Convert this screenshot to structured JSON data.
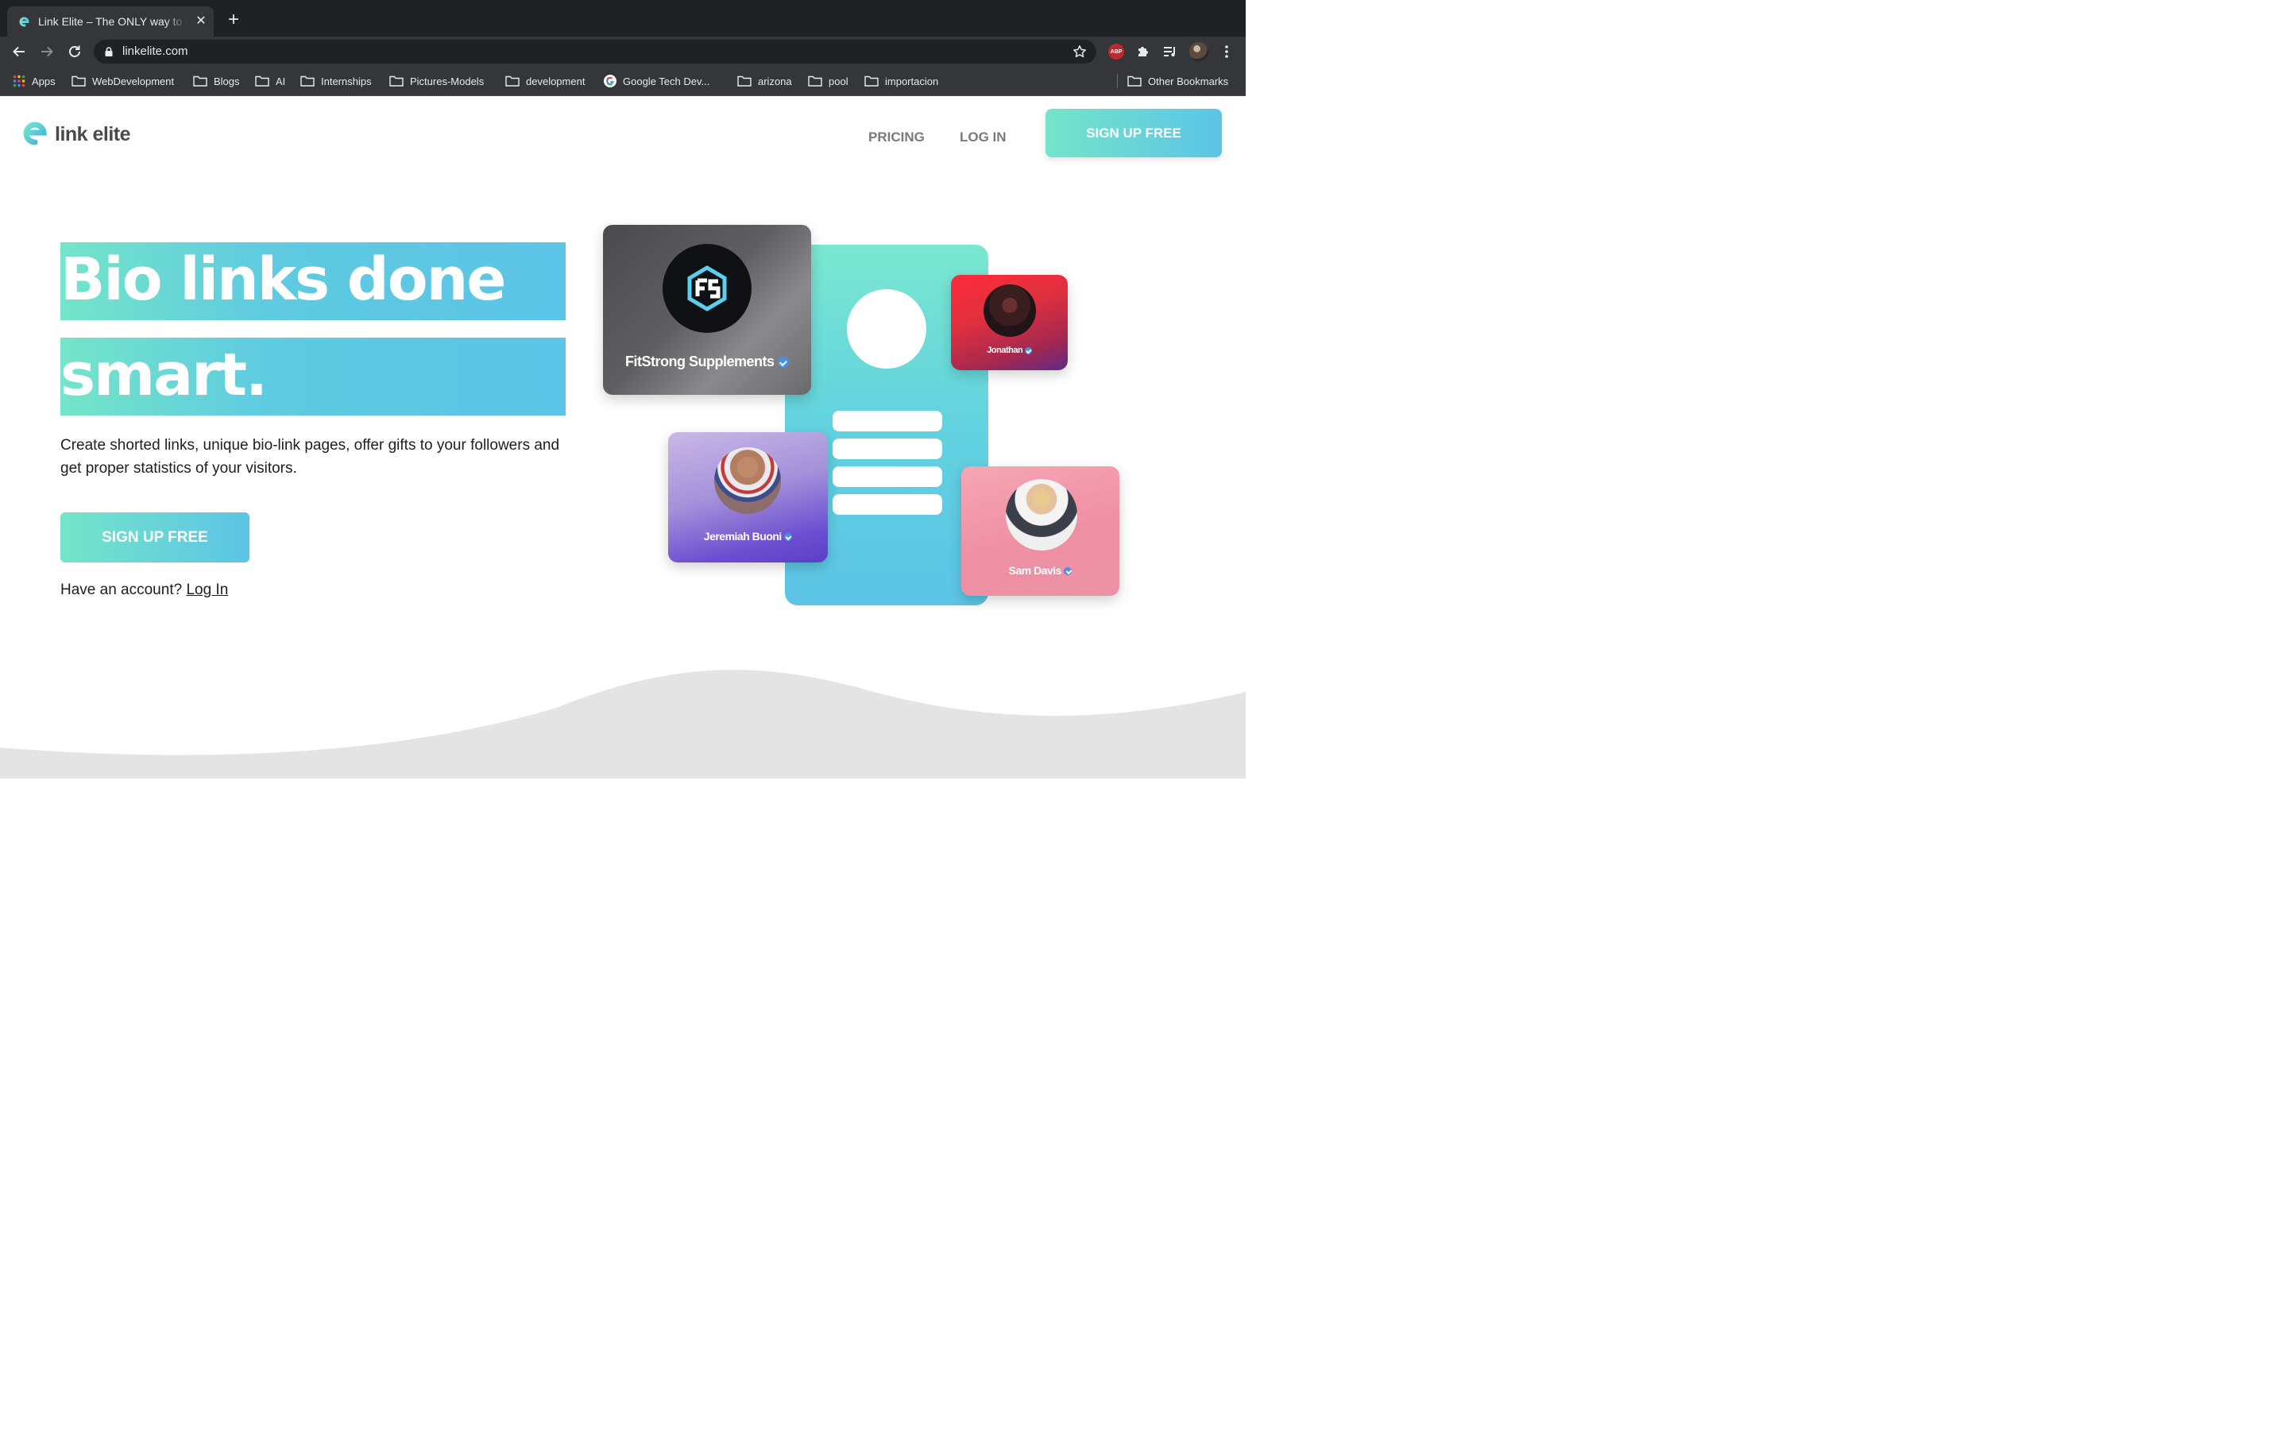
{
  "browser": {
    "tab_title": "Link Elite – The ONLY way to link",
    "url": "linkelite.com",
    "bookmarks": [
      {
        "label": "Apps",
        "icon": "apps-grid-icon"
      },
      {
        "label": "WebDevelopment",
        "icon": "folder-icon"
      },
      {
        "label": "Blogs",
        "icon": "folder-icon"
      },
      {
        "label": "AI",
        "icon": "folder-icon"
      },
      {
        "label": "Internships",
        "icon": "folder-icon"
      },
      {
        "label": "Pictures-Models",
        "icon": "folder-icon"
      },
      {
        "label": "development",
        "icon": "folder-icon"
      },
      {
        "label": "Google Tech Dev...",
        "icon": "google-icon"
      },
      {
        "label": "arizona",
        "icon": "folder-icon"
      },
      {
        "label": "pool",
        "icon": "folder-icon"
      },
      {
        "label": "importacion",
        "icon": "folder-icon"
      }
    ],
    "other_bookmarks": "Other Bookmarks",
    "extensions": {
      "abp_label": "ABP"
    }
  },
  "site": {
    "logo_text": "link elite",
    "nav": {
      "pricing": "PRICING",
      "login": "LOG IN",
      "signup": "SIGN UP FREE"
    },
    "hero": {
      "line1": "Bio links done",
      "line2": "smart.",
      "description": "Create shorted links, unique bio-link pages, offer gifts to your followers and get proper statistics of your visitors.",
      "cta": "SIGN UP FREE",
      "account_prompt": "Have an account?",
      "login_link": "Log In"
    },
    "cards": {
      "fitstrong": "FitStrong Supplements",
      "jonathan": "Jonathan",
      "jeremiah": "Jeremiah Buoni",
      "sam": "Sam Davis"
    }
  },
  "colors": {
    "accent_start": "#74e5c9",
    "accent_end": "#5cc4e6",
    "chrome_dark": "#202124",
    "chrome_mid": "#35363a"
  }
}
